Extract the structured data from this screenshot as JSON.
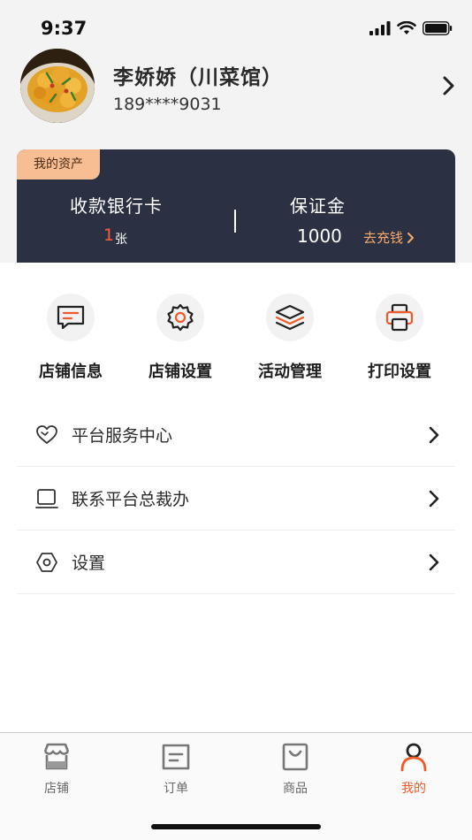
{
  "status_bar": {
    "time": "9:37"
  },
  "profile": {
    "name": "李娇娇（川菜馆）",
    "phone": "189****9031"
  },
  "assets": {
    "tag": "我的资产",
    "bank_card_label": "收款银行卡",
    "bank_card_count": "1",
    "bank_card_unit": "张",
    "deposit_label": "保证金",
    "deposit_amount": "1000",
    "recharge_label": "去充钱"
  },
  "shortcuts": [
    {
      "label": "店铺信息",
      "icon": "message-icon"
    },
    {
      "label": "店铺设置",
      "icon": "gear-icon"
    },
    {
      "label": "活动管理",
      "icon": "layers-icon"
    },
    {
      "label": "打印设置",
      "icon": "printer-icon"
    }
  ],
  "menu": [
    {
      "label": "平台服务中心",
      "icon": "heart-icon"
    },
    {
      "label": "联系平台总裁办",
      "icon": "laptop-icon"
    },
    {
      "label": "设置",
      "icon": "hexagon-nut-icon"
    }
  ],
  "tabbar": [
    {
      "label": "店铺",
      "icon": "store-icon",
      "active": false
    },
    {
      "label": "订单",
      "icon": "order-icon",
      "active": false
    },
    {
      "label": "商品",
      "icon": "bag-icon",
      "active": false
    },
    {
      "label": "我的",
      "icon": "person-icon",
      "active": true
    }
  ],
  "colors": {
    "accent": "#f05a28",
    "card_bg": "#2b3142",
    "tag_bg": "#f7be93",
    "count_red": "#ff5b3a"
  }
}
